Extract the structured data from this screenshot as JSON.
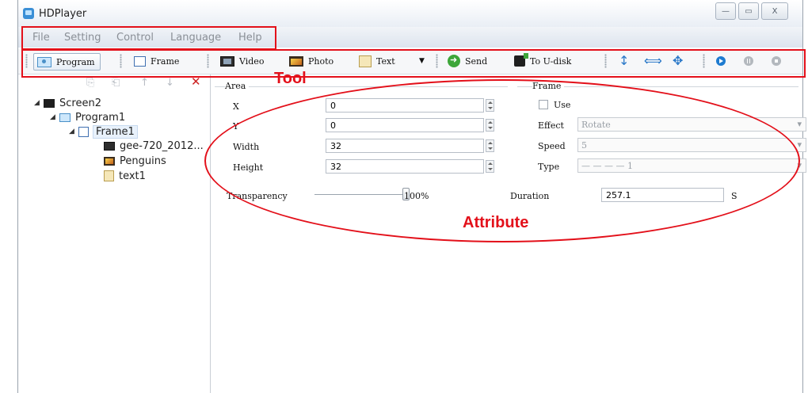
{
  "window": {
    "title": "HDPlayer",
    "buttons": {
      "minimize": "—",
      "maximize": "▭",
      "close": "X"
    }
  },
  "menu": [
    "File",
    "Setting",
    "Control",
    "Language",
    "Help"
  ],
  "toolbar": {
    "program": "Program",
    "frame": "Frame",
    "video": "Video",
    "photo": "Photo",
    "text": "Text",
    "text_dropdown": "▼",
    "send": "Send",
    "to_udisk": "To U-disk",
    "icons": [
      "vertical-arrows-icon",
      "horizontal-arrows-icon",
      "move-icon",
      "play-icon",
      "pause-icon",
      "stop-icon"
    ]
  },
  "tree": {
    "tools": {
      "copy": "⎘",
      "paste": "⎗",
      "up": "↑",
      "down": "↓",
      "delete": "✕"
    },
    "nodes": [
      {
        "label": "Screen2",
        "icon": "screen-icon"
      },
      {
        "label": "Program1",
        "icon": "program-icon"
      },
      {
        "label": "Frame1",
        "icon": "frame-icon"
      },
      {
        "label": "gee-720_2012...",
        "icon": "video-icon"
      },
      {
        "label": "Penguins",
        "icon": "photo-icon"
      },
      {
        "label": "text1",
        "icon": "text-icon"
      }
    ]
  },
  "area": {
    "title": "Area",
    "x_label": "X",
    "x_value": "0",
    "y_label": "Y",
    "y_value": "0",
    "width_label": "Width",
    "width_value": "32",
    "height_label": "Height",
    "height_value": "32",
    "transparency_label": "Transparency",
    "transparency_value": "100%",
    "transparency_level": 1.0
  },
  "frame": {
    "title": "Frame",
    "use_label": "Use",
    "effect_label": "Effect",
    "effect_value": "Rotate",
    "speed_label": "Speed",
    "speed_value": "5",
    "type_label": "Type",
    "type_value": "— — — — 1",
    "duration_label": "Duration",
    "duration_value": "257.1",
    "duration_unit": "S"
  },
  "annotations": {
    "tool": "Tool",
    "attribute": "Attribute"
  },
  "colors": {
    "annotation": "#e3101a",
    "accent": "#2a78c8"
  }
}
